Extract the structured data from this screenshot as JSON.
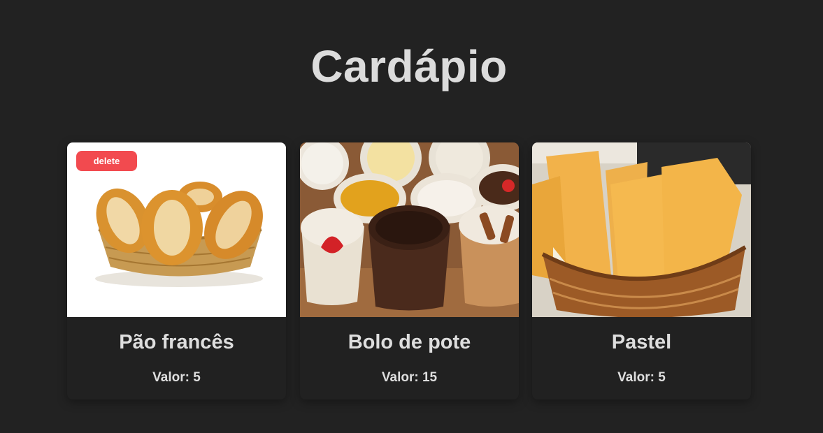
{
  "page": {
    "title": "Cardápio"
  },
  "colors": {
    "background": "#222222",
    "card": "#212121",
    "text": "#dedede",
    "delete": "#f24a4f"
  },
  "products": [
    {
      "name": "Pão francês",
      "price": "Valor: 5",
      "image": "bread-basket-photo",
      "delete_label": "delete"
    },
    {
      "name": "Bolo de pote",
      "price": "Valor: 15",
      "image": "cake-cups-photo"
    },
    {
      "name": "Pastel",
      "price": "Valor: 5",
      "image": "pastel-basket-photo"
    }
  ]
}
